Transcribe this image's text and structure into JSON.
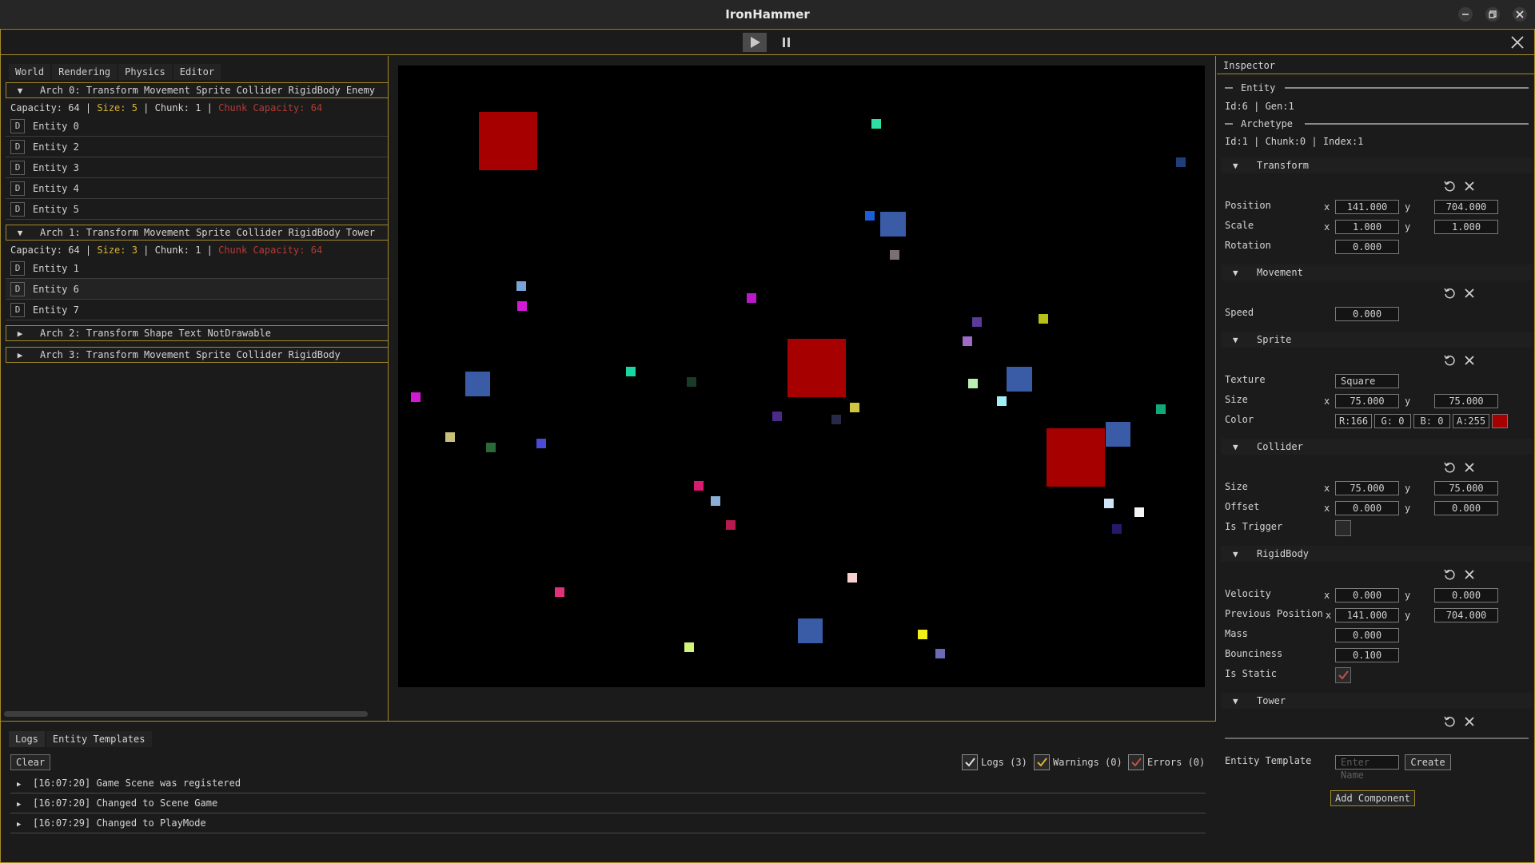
{
  "window": {
    "title": "IronHammer"
  },
  "world_tabs": [
    "World",
    "Rendering",
    "Physics",
    "Editor"
  ],
  "archetypes": [
    {
      "label": "Arch 0: Transform  Movement  Sprite  Collider  RigidBody  Enemy",
      "expanded": true,
      "cap_prefix": "Capacity: 64 | ",
      "size": "Size: 5",
      "chunk": " | Chunk: 1 | ",
      "chunk_cap": "Chunk Capacity: 64",
      "entities": [
        "Entity 0",
        "Entity 2",
        "Entity 3",
        "Entity 4",
        "Entity 5"
      ]
    },
    {
      "label": "Arch 1: Transform  Movement  Sprite  Collider  RigidBody  Tower",
      "expanded": true,
      "cap_prefix": "Capacity: 64 | ",
      "size": "Size: 3",
      "chunk": " | Chunk: 1 | ",
      "chunk_cap": "Chunk Capacity: 64",
      "entities": [
        "Entity 1",
        "Entity 6",
        "Entity 7"
      ]
    },
    {
      "label": "Arch 2: Transform  Shape  Text  NotDrawable",
      "expanded": false
    },
    {
      "label": "Arch 3: Transform  Movement  Sprite  Collider  RigidBody",
      "expanded": false
    }
  ],
  "entity_button": "D",
  "log_tabs": [
    "Logs",
    "Entity Templates"
  ],
  "log_clear": "Clear",
  "log_filters": [
    {
      "label": "Logs (3)",
      "checked": true,
      "check_color": "#e0e0e0"
    },
    {
      "label": "Warnings (0)",
      "checked": true,
      "check_color": "#d8b334"
    },
    {
      "label": "Errors (0)",
      "checked": true,
      "check_color": "#c0504d"
    }
  ],
  "logs": [
    "[16:07:20] Game Scene was registered",
    "[16:07:20] Changed to Scene Game",
    "[16:07:29] Changed to PlayMode"
  ],
  "inspector": {
    "title": "Inspector",
    "entity_section": "Entity",
    "entity_info": "Id:6 | Gen:1",
    "archetype_section": "Archetype",
    "archetype_info": "Id:1 | Chunk:0 | Index:1",
    "components": {
      "transform": {
        "name": "Transform",
        "position_label": "Position",
        "position_x": "141.000",
        "position_y": "704.000",
        "scale_label": "Scale",
        "scale_x": "1.000",
        "scale_y": "1.000",
        "rotation_label": "Rotation",
        "rotation": "0.000"
      },
      "movement": {
        "name": "Movement",
        "speed_label": "Speed",
        "speed": "0.000"
      },
      "sprite": {
        "name": "Sprite",
        "texture_label": "Texture",
        "texture": "Square",
        "size_label": "Size",
        "size_x": "75.000",
        "size_y": "75.000",
        "color_label": "Color",
        "r": "R:166",
        "g": "G: 0",
        "b": "B: 0",
        "a": "A:255",
        "swatch": "#a60000"
      },
      "collider": {
        "name": "Collider",
        "size_label": "Size",
        "size_x": "75.000",
        "size_y": "75.000",
        "offset_label": "Offset",
        "offset_x": "0.000",
        "offset_y": "0.000",
        "trigger_label": "Is Trigger",
        "is_trigger": false
      },
      "rigidbody": {
        "name": "RigidBody",
        "velocity_label": "Velocity",
        "velocity_x": "0.000",
        "velocity_y": "0.000",
        "prev_label": "Previous Position",
        "prev_x": "141.000",
        "prev_y": "704.000",
        "mass_label": "Mass",
        "mass": "0.000",
        "bounciness_label": "Bounciness",
        "bounciness": "0.100",
        "static_label": "Is Static",
        "is_static": true
      },
      "tower": {
        "name": "Tower"
      }
    },
    "axis_x": "x",
    "axis_y": "y",
    "template_label": "Entity Template",
    "template_placeholder": "Enter Name",
    "create_button": "Create",
    "add_component_button": "Add Component"
  },
  "scene_objects": [
    {
      "name": "enemy-large",
      "color": "#a60000"
    },
    {
      "name": "tower",
      "color": "#3a5ba6"
    },
    {
      "name": "particle",
      "color": "mixed"
    }
  ]
}
